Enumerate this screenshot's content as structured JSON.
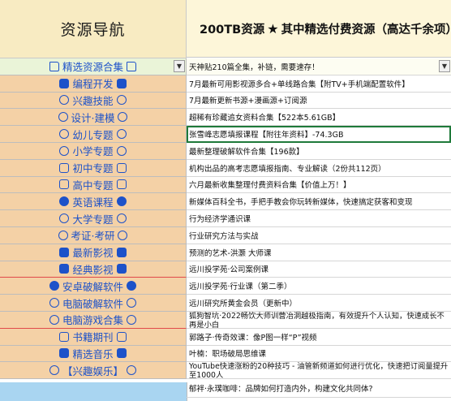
{
  "header": {
    "left_title": "资源导航",
    "right_title_a": "200TB资源",
    "right_title_b": "其中精选付费资源（高达千余项）"
  },
  "nav": {
    "items": [
      {
        "label": "精选资源合集",
        "icon": "folder-icon"
      },
      {
        "label": "编程开发",
        "icon": "monitor-icon"
      },
      {
        "label": "兴趣技能",
        "icon": "palette-icon"
      },
      {
        "label": "设计·建模",
        "icon": "design-icon"
      },
      {
        "label": "幼儿专题",
        "icon": "baby-icon"
      },
      {
        "label": "小学专题",
        "icon": "child-icon"
      },
      {
        "label": "初中专题",
        "icon": "student-icon"
      },
      {
        "label": "高中专题",
        "icon": "student-icon"
      },
      {
        "label": "英语课程",
        "icon": "cloud-icon"
      },
      {
        "label": "大学专题",
        "icon": "graduation-icon"
      },
      {
        "label": "考证·考研",
        "icon": "certificate-icon"
      },
      {
        "label": "最新影视",
        "icon": "clapper-icon"
      },
      {
        "label": "经典影视",
        "icon": "clapper-icon"
      },
      {
        "label": "安卓破解软件",
        "icon": "android-icon"
      },
      {
        "label": "电脑破解软件",
        "icon": "gear-icon"
      },
      {
        "label": "电脑游戏合集",
        "icon": "gamepad-icon"
      },
      {
        "label": "书籍期刊",
        "icon": "book-icon"
      },
      {
        "label": "精选音乐",
        "icon": "music-icon"
      },
      {
        "label": "【兴趣娱乐】",
        "icon": "smile-icon"
      }
    ]
  },
  "list": {
    "rows": [
      "天神贴210篇全集，补链，需要速存！",
      "7月最新可用影视源多合+单线路合集【附TV+手机端配置软件】",
      "7月最新更新书源+漫画源+订阅源",
      "超稀有珍藏追女资料合集【522本5.61GB】",
      "张雪峰志愿填报课程【附往年资料】-74.3GB",
      "最新整理破解软件合集【196款】",
      "机构出品的高考志愿填报指南、专业解读（2份共112页）",
      "六月最新收集整理付费资料合集【价值上万！】",
      "新媒体百科全书，手把手教会你玩转新媒体，快速搞定获客和变现",
      "行为经济学通识课",
      "行业研究方法与实战",
      "预测的艺术-洪灏 大师课",
      "远川投学苑·公司案例课",
      "远川投学苑·行业课（第二季）",
      "远川研究所黄金会员（更新中）",
      "狐狗智坑·2022畅饮大师训营冶洞越极指南，有效提升个人认知，快速成长不再是小白",
      "郭路子·传奇效课：像P图一样“P”视频",
      "叶楠：职场破局思维课",
      "YouTube快速涨粉的20种技巧 - 油管新频道如何进行优化，快速把订阅量提升至1000人",
      "郁袢·永璞咖啡：品牌如何打造内外，构建文化共同体?"
    ]
  },
  "colors": {
    "nav_bg": "#f4d1a6",
    "nav_first_bg": "#eaf4d8",
    "nav_text": "#1d52c9",
    "header_left_bg": "#f8ebc2",
    "header_right_bg": "#fdf6d9",
    "footer_bg": "#a9d5f1",
    "selection": "#1f7a3a"
  }
}
